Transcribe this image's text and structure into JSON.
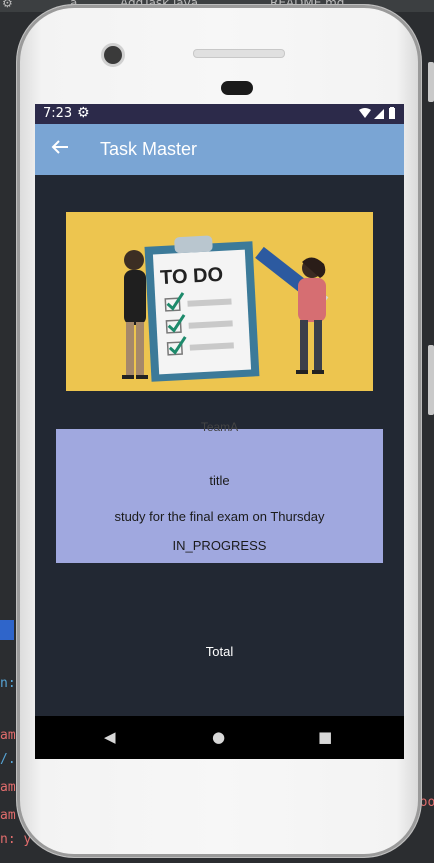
{
  "ide": {
    "tab1": "a",
    "tab2": "AddTask.java",
    "tab3": "README.md",
    "code_right": [
      "o",
      "S",
      "s",
      "a",
      "D",
      "t",
      "shoo"
    ],
    "code_left": [
      "n:",
      "am",
      "/.",
      "am",
      "am",
      "n: y"
    ]
  },
  "status_bar": {
    "time": "7:23",
    "signal": "▾◢▮"
  },
  "app_bar": {
    "title": "Task Master"
  },
  "hero_image": {
    "text": "TO DO"
  },
  "task_card": {
    "team": "TeamA",
    "title": "title",
    "body": "study for the final exam on Thursday",
    "state": "IN_PROGRESS"
  },
  "total_label": "Total",
  "nav": {
    "back": "◀",
    "home": "●",
    "recents": "■"
  }
}
